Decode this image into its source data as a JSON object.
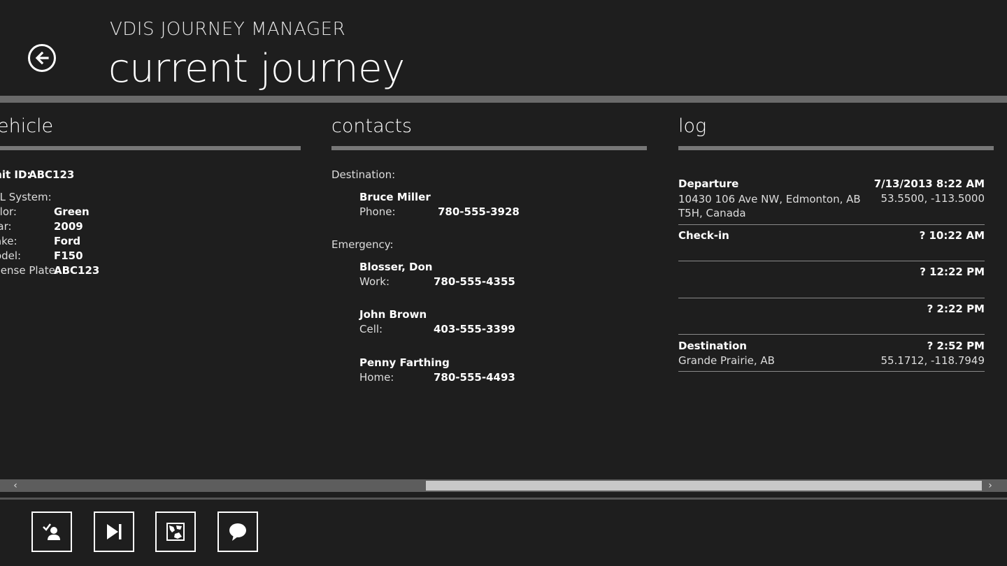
{
  "header": {
    "app_title": "VDIS JOURNEY MANAGER",
    "page_title": "current journey"
  },
  "vehicle": {
    "heading": "vehicle",
    "unit_id_label": "Unit ID:",
    "unit_id_value": "ABC123",
    "avl_label": "AVL System:",
    "fields": [
      {
        "label": "Color:",
        "value": "Green"
      },
      {
        "label": "Year:",
        "value": "2009"
      },
      {
        "label": "Make:",
        "value": "Ford"
      },
      {
        "label": "Model:",
        "value": "F150"
      },
      {
        "label": "License Plate:",
        "value": "ABC123"
      }
    ]
  },
  "contacts": {
    "heading": "contacts",
    "destination_label": "Destination:",
    "destination": {
      "name": "Bruce Miller",
      "phone_label": "Phone:",
      "phone": "780-555-3928"
    },
    "emergency_label": "Emergency:",
    "emergency": [
      {
        "name": "Blosser, Don",
        "type": "Work:",
        "phone": "780-555-4355"
      },
      {
        "name": "John Brown",
        "type": "Cell:",
        "phone": "403-555-3399"
      },
      {
        "name": "Penny Farthing",
        "type": "Home:",
        "phone": "780-555-4493"
      }
    ]
  },
  "log": {
    "heading": "log",
    "entries": [
      {
        "title": "Departure",
        "time": "7/13/2013 8:22 AM",
        "address": "10430 106 Ave NW, Edmonton, AB T5H, Canada",
        "coords": "53.5500, -113.5000"
      },
      {
        "title": "Check-in",
        "time": "? 10:22 AM",
        "address": "",
        "coords": ""
      },
      {
        "title": "",
        "time": "? 12:22 PM",
        "address": "",
        "coords": ""
      },
      {
        "title": "",
        "time": "? 2:22 PM",
        "address": "",
        "coords": ""
      },
      {
        "title": "Destination",
        "time": "? 2:52 PM",
        "address": "Grande Prairie, AB",
        "coords": "55.1712, -118.7949"
      }
    ]
  },
  "scroll": {
    "left_arrow": "‹",
    "right_arrow": "›"
  },
  "app_bar": {
    "buttons": [
      {
        "icon": "check-in-person-icon"
      },
      {
        "icon": "skip-next-icon"
      },
      {
        "icon": "map-icon"
      },
      {
        "icon": "comment-icon"
      }
    ]
  }
}
